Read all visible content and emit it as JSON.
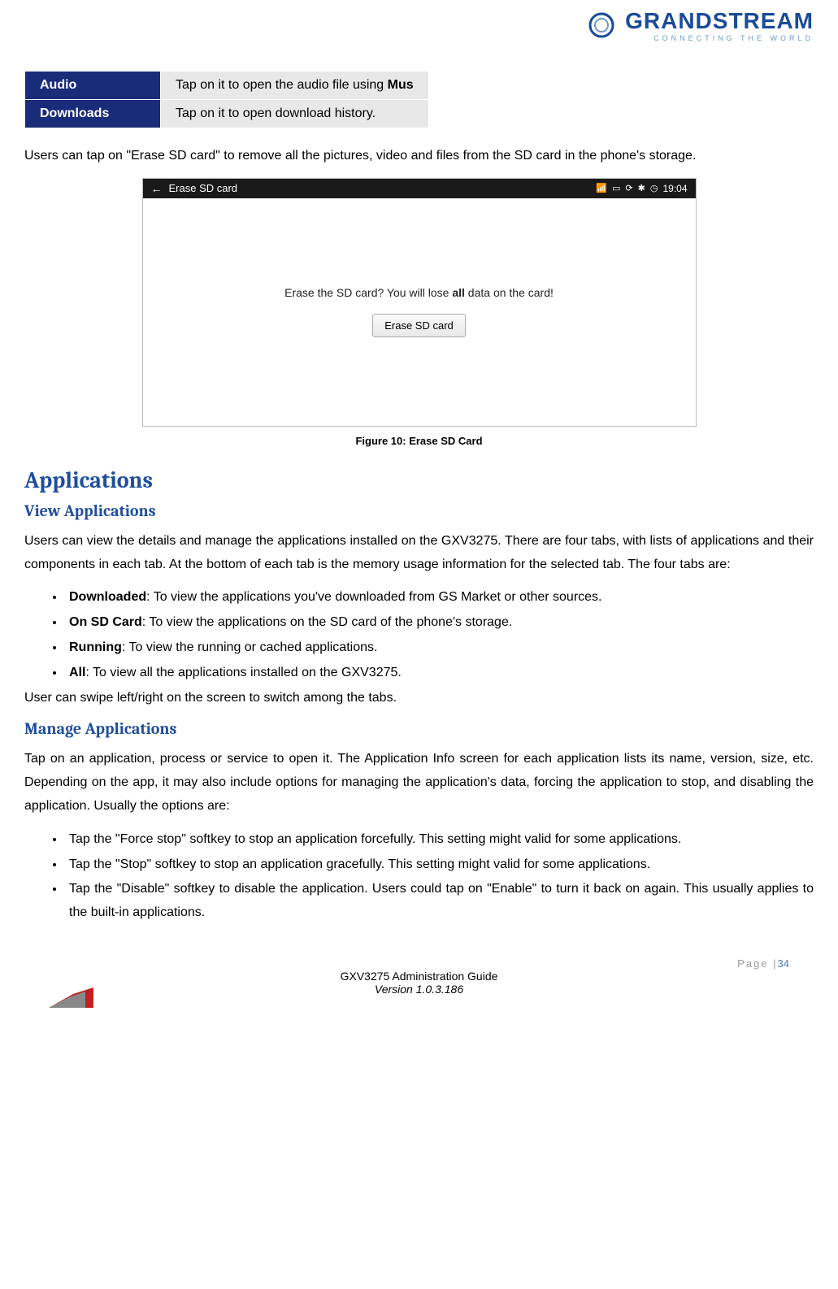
{
  "logo": {
    "brand": "GRANDSTREAM",
    "tagline": "CONNECTING THE WORLD"
  },
  "table": {
    "rows": [
      {
        "label": "Audio",
        "desc_pre": "Tap on it to open the audio file using ",
        "desc_bold": "Mus"
      },
      {
        "label": "Downloads",
        "desc_pre": "Tap on it to open download history.",
        "desc_bold": ""
      }
    ]
  },
  "para_intro": "Users can tap on \"Erase SD card\" to remove all the pictures, video and files from the SD card in the phone's storage.",
  "screenshot": {
    "back_icon": "←",
    "title": "Erase SD card",
    "time": "19:04",
    "dialog_pre": "Erase the SD card? You will lose ",
    "dialog_bold": "all",
    "dialog_post": " data on the card!",
    "button": "Erase SD card"
  },
  "caption": "Figure 10: Erase SD Card",
  "h1_apps": "Applications",
  "h2_view": "View Applications",
  "para_view": "Users can view the details and manage the applications installed on the GXV3275. There are four tabs, with lists of applications and their components in each tab. At the bottom of each tab is the memory usage information for the selected tab. The four tabs are:",
  "tabs_list": [
    {
      "label": "Downloaded",
      "desc": ": To view the applications you've downloaded from GS Market or other sources."
    },
    {
      "label": "On SD Card",
      "desc": ": To view the applications on the SD card of the phone's storage."
    },
    {
      "label": "Running",
      "desc": ": To view the running or cached applications."
    },
    {
      "label": "All",
      "desc": ": To view all the applications installed on the GXV3275."
    }
  ],
  "para_swipe": "User can swipe left/right on the screen to switch among the tabs.",
  "h2_manage": "Manage Applications",
  "para_manage": "Tap on an application, process or service to open it. The Application Info screen for each application lists its name, version, size, etc. Depending on the app, it may also include options for managing the application's data, forcing the application to stop, and disabling the application. Usually the options are:",
  "manage_list": [
    "Tap the \"Force stop\" softkey to stop an application forcefully. This setting might valid for some applications.",
    "Tap the \"Stop\" softkey to stop an application gracefully. This setting might valid for some applications.",
    "Tap the \"Disable\" softkey to disable the application. Users could tap on \"Enable\" to turn it back on again. This usually applies to the built-in applications."
  ],
  "footer": {
    "page_label": "Page |",
    "page_num": "34",
    "guide": "GXV3275 Administration Guide",
    "version_label": "Version ",
    "version": "1.0.3.186"
  }
}
